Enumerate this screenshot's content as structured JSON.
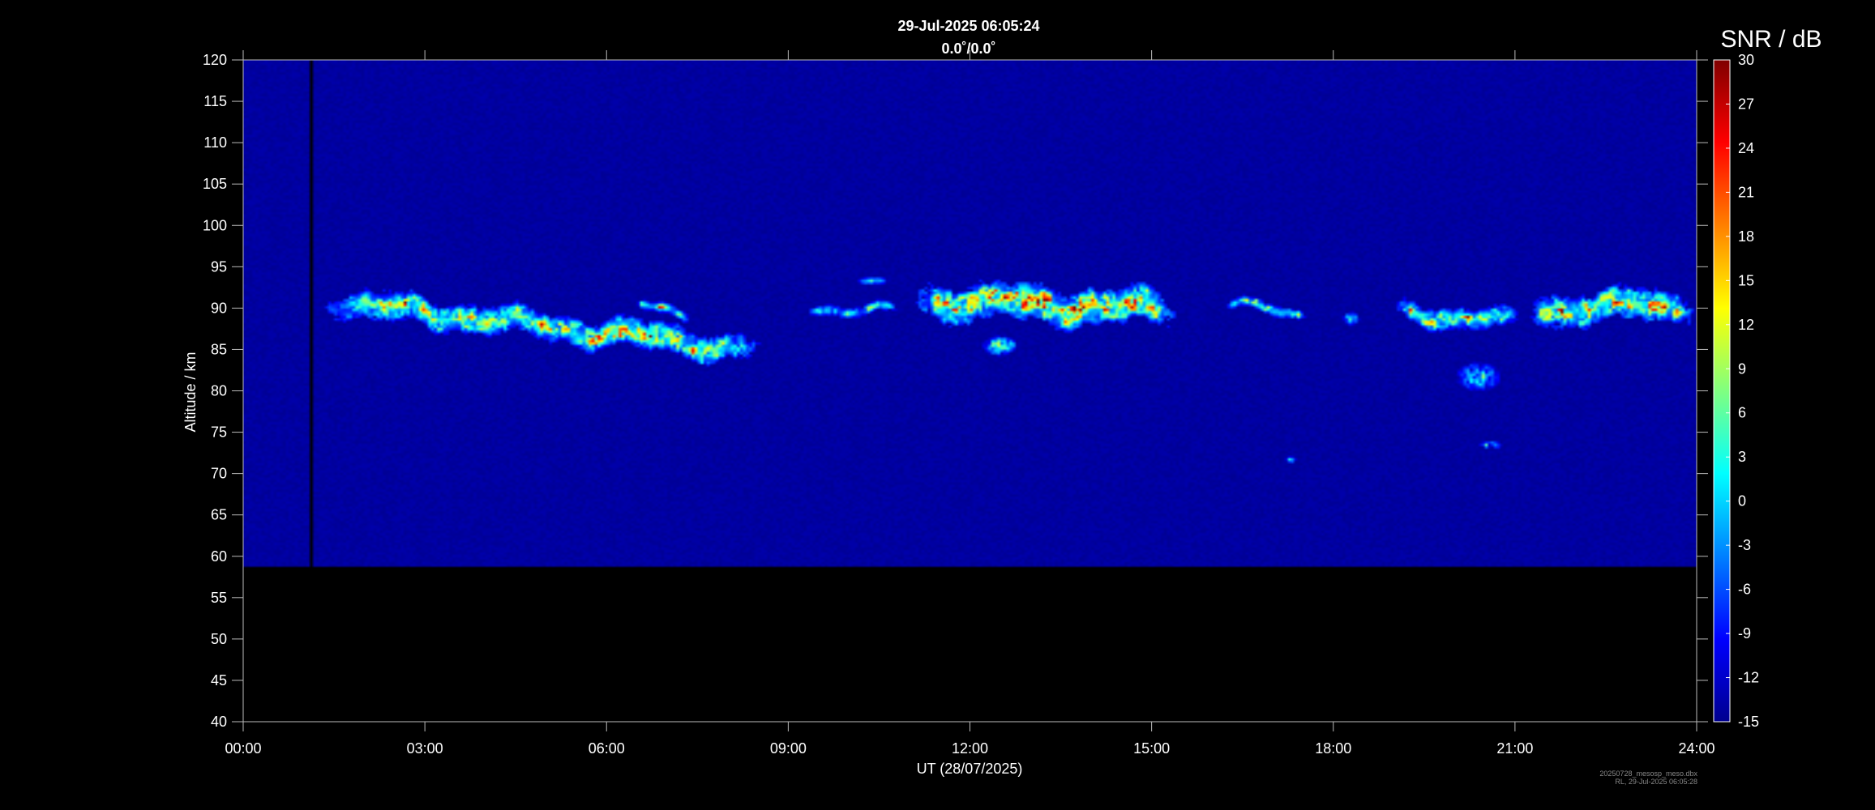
{
  "chart_data": {
    "type": "heatmap",
    "title": "29-Jul-2025 06:05:24",
    "subtitle": "0.0˚/0.0˚",
    "xlabel": "UT (28/07/2025)",
    "ylabel": "Altitude / km",
    "x_ticks": [
      "00:00",
      "03:00",
      "06:00",
      "09:00",
      "12:00",
      "15:00",
      "18:00",
      "21:00",
      "24:00"
    ],
    "xlim_hours": [
      0,
      24
    ],
    "y_ticks": [
      120,
      115,
      110,
      105,
      100,
      95,
      90,
      85,
      80,
      75,
      70,
      65,
      60,
      55,
      50,
      45,
      40
    ],
    "ylim": [
      40,
      120
    ],
    "data_altitude_range_km": [
      50,
      120
    ],
    "data_gap_hours": [
      1.08,
      1.14
    ],
    "colorbar": {
      "label": "SNR / dB",
      "range": [
        -15,
        30
      ],
      "ticks": [
        30,
        27,
        24,
        21,
        18,
        15,
        12,
        9,
        6,
        3,
        0,
        -3,
        -6,
        -9,
        -12,
        -15
      ],
      "colormap": "jet",
      "stops": [
        "#00008f",
        "#0000ff",
        "#0080ff",
        "#00ffff",
        "#80ff80",
        "#ffff00",
        "#ff8000",
        "#ff0000",
        "#800000"
      ]
    },
    "background_color": "#000000",
    "echo_layers": [
      {
        "start_h": 1.2,
        "end_h": 8.7,
        "alt_start_km": 86.8,
        "alt_end_km": 79.8,
        "thickness_km": 4,
        "peak_snr_db": 22
      },
      {
        "start_h": 6.5,
        "end_h": 7.4,
        "alt_start_km": 86.0,
        "alt_end_km": 84.6,
        "thickness_km": 1.5,
        "peak_snr_db": 14
      },
      {
        "start_h": 9.3,
        "end_h": 10.8,
        "alt_start_km": 86.0,
        "alt_end_km": 85.0,
        "thickness_km": 1.5,
        "peak_snr_db": 10
      },
      {
        "start_h": 11.0,
        "end_h": 15.5,
        "alt_start_km": 86.8,
        "alt_end_km": 85.5,
        "thickness_km": 5,
        "peak_snr_db": 28
      },
      {
        "start_h": 16.2,
        "end_h": 17.6,
        "alt_start_km": 86.2,
        "alt_end_km": 84.6,
        "thickness_km": 1.5,
        "peak_snr_db": 12
      },
      {
        "start_h": 19.0,
        "end_h": 21.1,
        "alt_start_km": 85.6,
        "alt_end_km": 83.4,
        "thickness_km": 3,
        "peak_snr_db": 20
      },
      {
        "start_h": 21.2,
        "end_h": 24.0,
        "alt_start_km": 85.6,
        "alt_end_km": 86.2,
        "thickness_km": 4.5,
        "peak_snr_db": 25
      }
    ],
    "echo_patches": [
      {
        "t_h": 12.5,
        "alt_km": 80.5,
        "dt_h": 0.3,
        "dalt_km": 1.5,
        "peak_snr_db": 10
      },
      {
        "t_h": 20.4,
        "alt_km": 76.2,
        "dt_h": 0.4,
        "dalt_km": 2.2,
        "peak_snr_db": 4
      },
      {
        "t_h": 20.6,
        "alt_km": 66.8,
        "dt_h": 0.2,
        "dalt_km": 0.6,
        "peak_snr_db": 5
      },
      {
        "t_h": 17.3,
        "alt_km": 64.8,
        "dt_h": 0.1,
        "dalt_km": 0.5,
        "peak_snr_db": 3
      },
      {
        "t_h": 10.4,
        "alt_km": 89.5,
        "dt_h": 0.3,
        "dalt_km": 0.6,
        "peak_snr_db": 4
      },
      {
        "t_h": 18.3,
        "alt_km": 84.3,
        "dt_h": 0.15,
        "dalt_km": 1.0,
        "peak_snr_db": 6
      }
    ]
  },
  "footer": {
    "line1": "20250728_mesosp_meso.dbx",
    "line2": "RL, 29-Jul-2025 06:05:28"
  }
}
